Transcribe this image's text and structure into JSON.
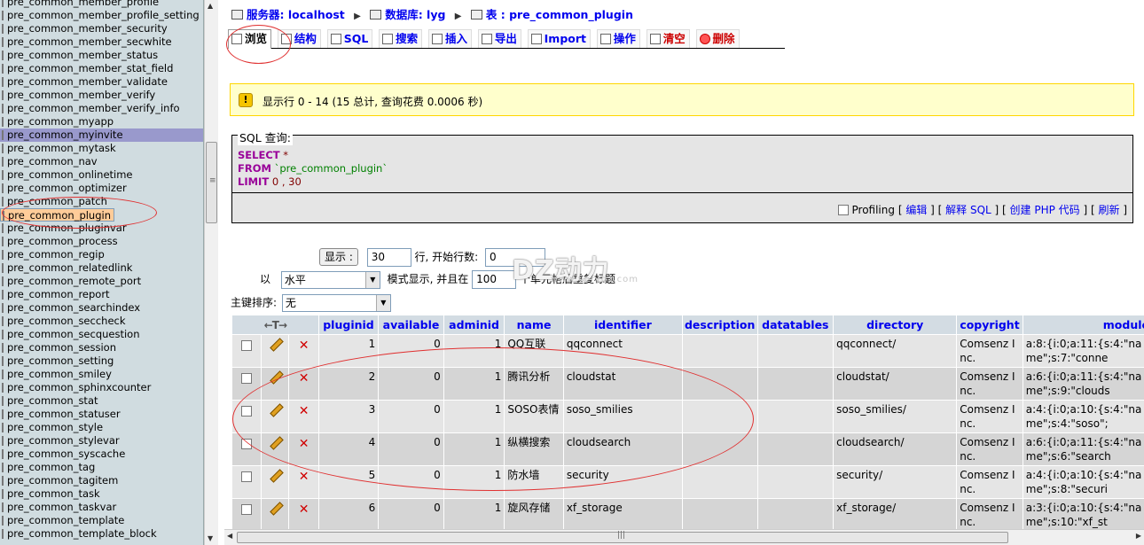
{
  "sidebar": {
    "tables": [
      "pre_common_member_profile",
      "pre_common_member_profile_setting",
      "pre_common_member_security",
      "pre_common_member_secwhite",
      "pre_common_member_status",
      "pre_common_member_stat_field",
      "pre_common_member_validate",
      "pre_common_member_verify",
      "pre_common_member_verify_info",
      "pre_common_myapp",
      "pre_common_myinvite",
      "pre_common_mytask",
      "pre_common_nav",
      "pre_common_onlinetime",
      "pre_common_optimizer",
      "pre_common_patch",
      "pre_common_plugin",
      "pre_common_pluginvar",
      "pre_common_process",
      "pre_common_regip",
      "pre_common_relatedlink",
      "pre_common_remote_port",
      "pre_common_report",
      "pre_common_searchindex",
      "pre_common_seccheck",
      "pre_common_secquestion",
      "pre_common_session",
      "pre_common_setting",
      "pre_common_smiley",
      "pre_common_sphinxcounter",
      "pre_common_stat",
      "pre_common_statuser",
      "pre_common_style",
      "pre_common_stylevar",
      "pre_common_syscache",
      "pre_common_tag",
      "pre_common_tagitem",
      "pre_common_task",
      "pre_common_taskvar",
      "pre_common_template",
      "pre_common_template_block"
    ],
    "hover_item": "pre_common_myinvite",
    "selected_item": "pre_common_plugin"
  },
  "breadcrumb": {
    "server_label": "服务器:",
    "server": "localhost",
    "db_label": "数据库:",
    "db": "lyg",
    "table_label": "表 :",
    "table": "pre_common_plugin"
  },
  "tabs": [
    "浏览",
    "结构",
    "SQL",
    "搜索",
    "插入",
    "导出",
    "Import",
    "操作",
    "清空",
    "删除"
  ],
  "notice": "显示行 0 - 14 (15 总计, 查询花费 0.0006 秒)",
  "sql_box": {
    "legend": "SQL 查询:",
    "kw_select": "SELECT",
    "star": "*",
    "kw_from": "FROM",
    "table_str": "`pre_common_plugin`",
    "kw_limit": "LIMIT",
    "limit_args": "0 , 30",
    "profiling": "Profiling",
    "link_edit": "编辑",
    "link_explain": "解释 SQL",
    "link_php": "创建 PHP 代码",
    "link_refresh": "刷新"
  },
  "controls": {
    "show_button": "显示 :",
    "rows_value": "30",
    "rows_label": "行, 开始行数:",
    "start_value": "0",
    "with_label": "以",
    "mode_value": "水平",
    "mode_label": "模式显示, 并且在",
    "repeat_value": "100",
    "repeat_label": "个单元格后重复标题",
    "sort_label": "主键排序:",
    "sort_value": "无"
  },
  "watermark": {
    "main": "DZ动力",
    "sub": "www.verydz.com"
  },
  "table": {
    "sort_arrows": "←T→",
    "columns": [
      "pluginid",
      "available",
      "adminid",
      "name",
      "identifier",
      "description",
      "datatables",
      "directory",
      "copyright",
      "module"
    ],
    "rows": [
      {
        "pluginid": "1",
        "available": "0",
        "adminid": "1",
        "name": "QQ互联",
        "identifier": "qqconnect",
        "description": "",
        "datatables": "",
        "directory": "qqconnect/",
        "copyright": "Comsenz Inc.",
        "module": "a:8:{i:0;a:11:{s:4:\"name\";s:7:\"conne"
      },
      {
        "pluginid": "2",
        "available": "0",
        "adminid": "1",
        "name": "腾讯分析",
        "identifier": "cloudstat",
        "description": "",
        "datatables": "",
        "directory": "cloudstat/",
        "copyright": "Comsenz Inc.",
        "module": "a:6:{i:0;a:11:{s:4:\"name\";s:9:\"clouds"
      },
      {
        "pluginid": "3",
        "available": "0",
        "adminid": "1",
        "name": "SOSO表情",
        "identifier": "soso_smilies",
        "description": "",
        "datatables": "",
        "directory": "soso_smilies/",
        "copyright": "Comsenz Inc.",
        "module": "a:4:{i:0;a:10:{s:4:\"name\";s:4:\"soso\";"
      },
      {
        "pluginid": "4",
        "available": "0",
        "adminid": "1",
        "name": "纵横搜索",
        "identifier": "cloudsearch",
        "description": "",
        "datatables": "",
        "directory": "cloudsearch/",
        "copyright": "Comsenz Inc.",
        "module": "a:6:{i:0;a:11:{s:4:\"name\";s:6:\"search"
      },
      {
        "pluginid": "5",
        "available": "0",
        "adminid": "1",
        "name": "防水墙",
        "identifier": "security",
        "description": "",
        "datatables": "",
        "directory": "security/",
        "copyright": "Comsenz Inc.",
        "module": "a:4:{i:0;a:10:{s:4:\"name\";s:8:\"securi"
      },
      {
        "pluginid": "6",
        "available": "0",
        "adminid": "1",
        "name": "旋风存储",
        "identifier": "xf_storage",
        "description": "",
        "datatables": "",
        "directory": "xf_storage/",
        "copyright": "Comsenz Inc.",
        "module": "a:3:{i:0;a:10:{s:4:\"name\";s:10:\"xf_st"
      }
    ]
  }
}
